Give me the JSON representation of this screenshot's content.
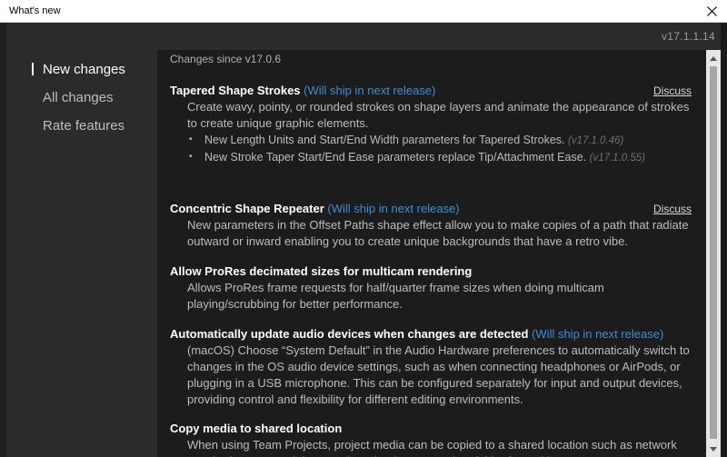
{
  "titlebar": {
    "title": "What's new",
    "close_icon": "close-icon"
  },
  "version": "v17.1.1.14",
  "sidebar": {
    "items": [
      {
        "label": "New changes",
        "active": true
      },
      {
        "label": "All changes",
        "active": false
      },
      {
        "label": "Rate features",
        "active": false
      }
    ]
  },
  "content": {
    "since_label": "Changes since v17.0.6",
    "features": [
      {
        "title": "Tapered Shape Strokes",
        "ship": "(Will ship in next release)",
        "discuss": "Discuss",
        "description": "Create wavy, pointy, or rounded strokes on shape layers and animate the appearance of strokes to create unique graphic elements.",
        "bullets": [
          {
            "text": "New Length Units and Start/End Width parameters for Tapered Strokes.",
            "version": "(v17.1.0.46)"
          },
          {
            "text": "New Stroke Taper Start/End Ease parameters replace Tip/Attachment Ease.",
            "version": "(v17.1.0.55)"
          }
        ]
      },
      {
        "title": "Concentric Shape Repeater",
        "ship": "(Will ship in next release)",
        "discuss": "Discuss",
        "description": "New parameters in the Offset Paths shape effect allow you to make copies of a path that radiate outward or inward enabling you to create unique backgrounds that have a retro vibe."
      },
      {
        "title": "Allow ProRes decimated sizes for multicam rendering",
        "description": "Allows ProRes frame requests for half/quarter frame sizes when doing multicam playing/scrubbing for better performance."
      },
      {
        "title": "Automatically update audio devices when changes are detected",
        "ship": "(Will ship in next release)",
        "description": "(macOS) Choose “System Default” in the Audio Hardware preferences to automatically switch to changes in the OS audio device settings, such as when connecting headphones or AirPods, or plugging in a USB microphone.  This can be configured separately for input and output devices, providing control and flexibility for different editing environments."
      },
      {
        "title": "Copy media to shared location",
        "description": "When using Team Projects, project media can be copied to a shared location such as network attached storage, Adobe Creative Cloud, or a Dropbox folder for multi-user access."
      }
    ]
  }
}
